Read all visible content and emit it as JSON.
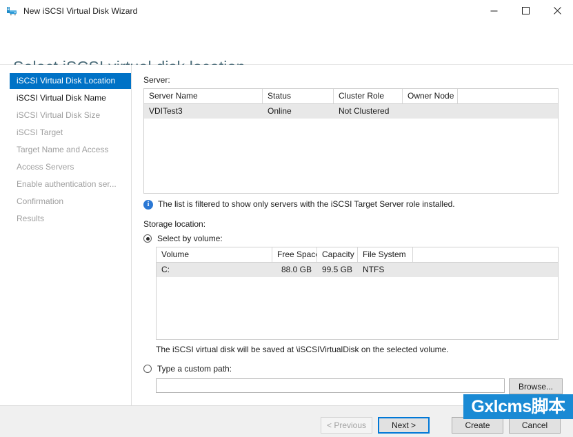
{
  "window": {
    "title": "New iSCSI Virtual Disk Wizard",
    "icon": "iscsi-disk-icon",
    "minimize": "—",
    "maximize": "□",
    "close": "✕"
  },
  "page": {
    "heading": "Select iSCSI virtual disk location"
  },
  "sidebar": {
    "items": [
      {
        "label": "iSCSI Virtual Disk Location",
        "state": "current"
      },
      {
        "label": "iSCSI Virtual Disk Name",
        "state": "done"
      },
      {
        "label": "iSCSI Virtual Disk Size",
        "state": "pending"
      },
      {
        "label": "iSCSI Target",
        "state": "pending"
      },
      {
        "label": "Target Name and Access",
        "state": "pending"
      },
      {
        "label": "Access Servers",
        "state": "pending"
      },
      {
        "label": "Enable authentication ser...",
        "state": "pending"
      },
      {
        "label": "Confirmation",
        "state": "pending"
      },
      {
        "label": "Results",
        "state": "pending"
      }
    ]
  },
  "main": {
    "server_label": "Server:",
    "server_table": {
      "columns": [
        "Server Name",
        "Status",
        "Cluster Role",
        "Owner Node"
      ],
      "rows": [
        {
          "cells": [
            "VDITest3",
            "Online",
            "Not Clustered",
            ""
          ],
          "selected": true
        }
      ]
    },
    "info": {
      "icon": "info-icon",
      "glyph": "i",
      "text": "The list is filtered to show only servers with the iSCSI Target Server role installed."
    },
    "storage_label": "Storage location:",
    "option_volume": {
      "label": "Select by volume:",
      "checked": true
    },
    "volume_table": {
      "columns": [
        "Volume",
        "Free Space",
        "Capacity",
        "File System"
      ],
      "rows": [
        {
          "cells": [
            "C:",
            "88.0 GB",
            "99.5 GB",
            "NTFS"
          ],
          "selected": true
        }
      ]
    },
    "save_note": "The iSCSI virtual disk will be saved at \\iSCSIVirtualDisk on the selected volume.",
    "option_custom": {
      "label": "Type a custom path:",
      "checked": false
    },
    "custom_path": {
      "value": "",
      "placeholder": ""
    },
    "browse_button": "Browse..."
  },
  "footer": {
    "previous": "< Previous",
    "next": "Next >",
    "create": "Create",
    "cancel": "Cancel"
  },
  "watermark": {
    "text": "Gxlcms脚本",
    "color": "#1a8ad4"
  }
}
